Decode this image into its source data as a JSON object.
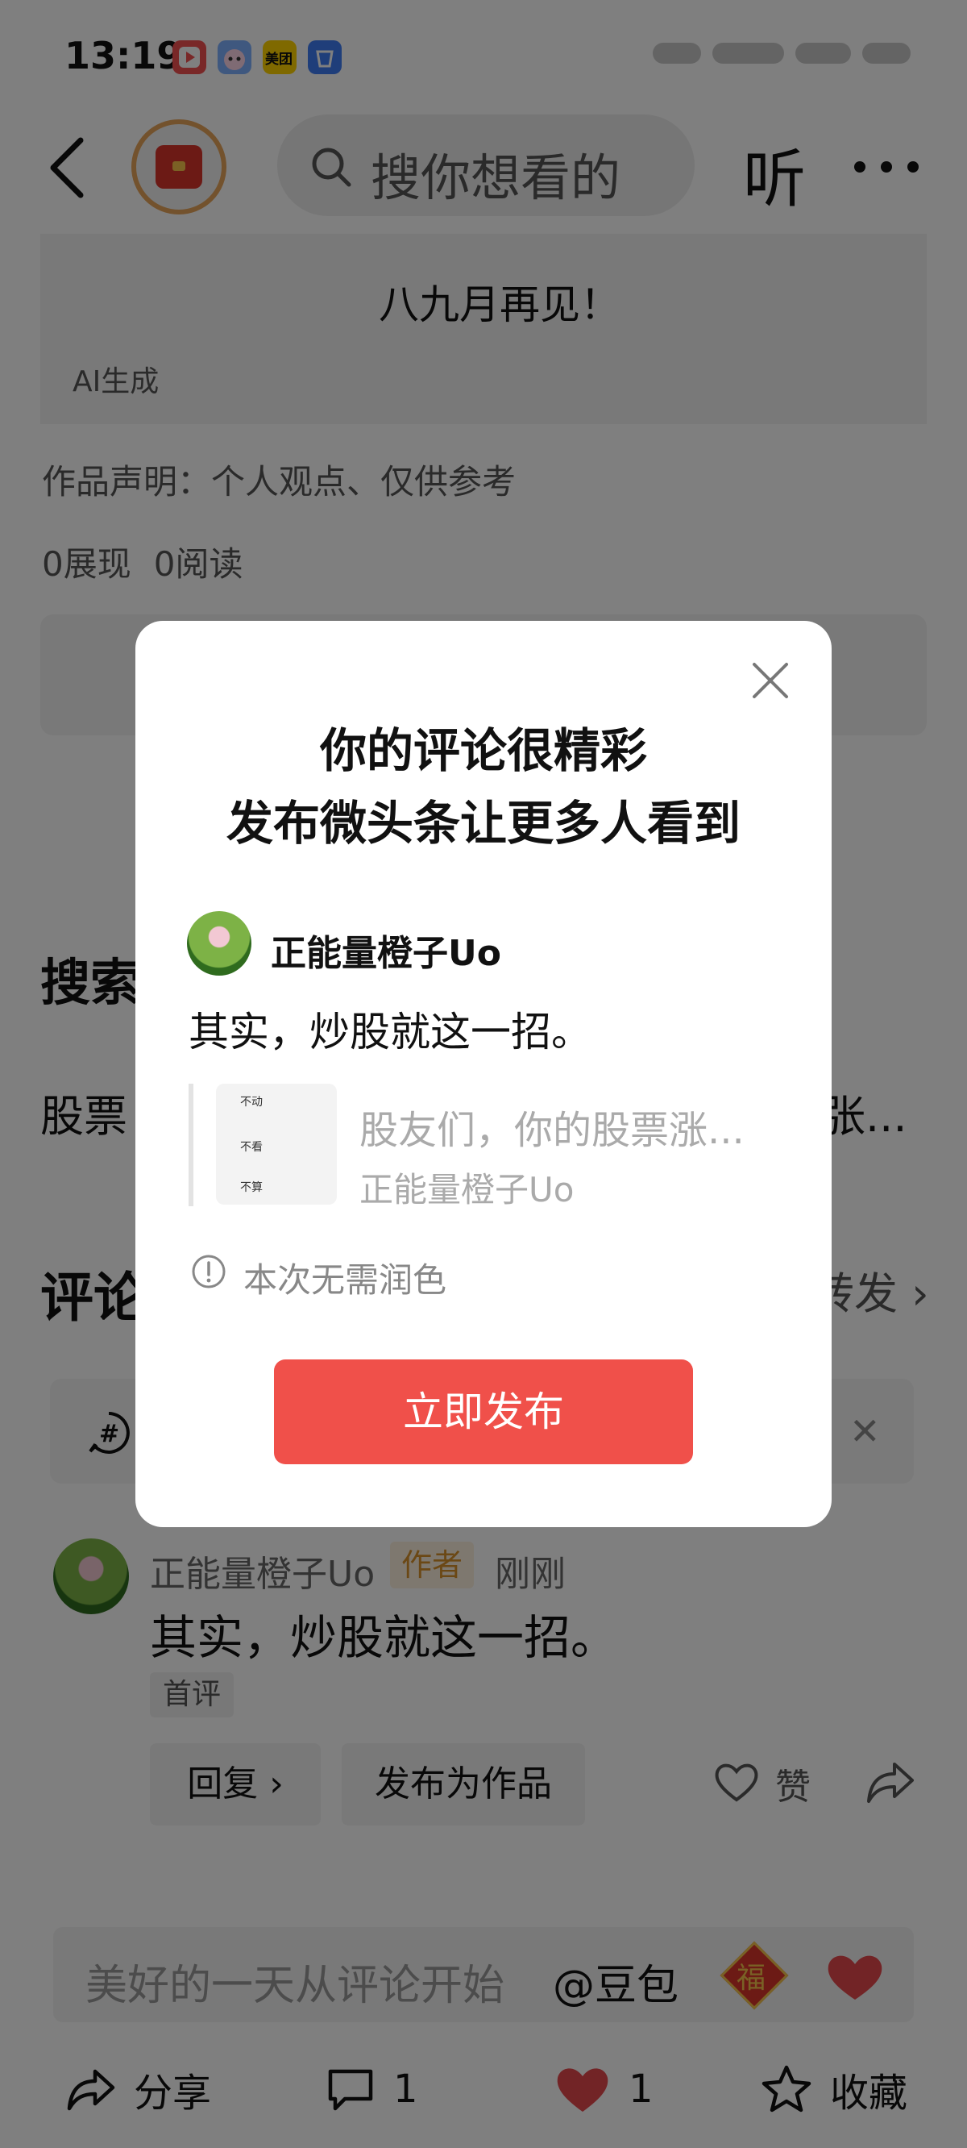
{
  "status_bar": {
    "time": "13:19",
    "app_icons": [
      "video-app-icon",
      "bot-app-icon",
      "meituan-app-icon",
      "app-market-icon"
    ],
    "meituan_label": "美团"
  },
  "top_bar": {
    "search_placeholder": "搜你想看的",
    "listen_label": "听"
  },
  "article": {
    "image_caption": "八九月再见！",
    "ai_tag": "AI生成",
    "statement": "作品声明：个人观点、仅供参考",
    "views": "0展现",
    "reads": "0阅读"
  },
  "search_section": {
    "heading": "搜索",
    "query_prefix": "股票",
    "query_suffix": "张..."
  },
  "comments": {
    "heading": "评论",
    "forward_label": "转发",
    "items": [
      {
        "author": "正能量橙子Uo",
        "badge": "作者",
        "time": "刚刚",
        "text": "其实，炒股就这一招。",
        "first_tag": "首评",
        "reply_label": "回复",
        "publish_as_work_label": "发布为作品",
        "like_label": "赞"
      }
    ]
  },
  "input_bar": {
    "placeholder": "美好的一天从评论开始",
    "mention": "@豆包",
    "fu_char": "福"
  },
  "bottom_bar": {
    "share": "分享",
    "comments_count": "1",
    "likes_count": "1",
    "collect": "收藏"
  },
  "modal": {
    "title_line1": "你的评论很精彩",
    "title_line2": "发布微头条让更多人看到",
    "author": "正能量橙子Uo",
    "text": "其实，炒股就这一招。",
    "quote_title": "股友们，你的股票涨...",
    "quote_author": "正能量橙子Uo",
    "thumb_lines": [
      "不动",
      "不看",
      "不算"
    ],
    "info": "本次无需润色",
    "publish_label": "立即发布"
  },
  "colors": {
    "accent": "#f0504a",
    "author_badge": "#d7902b",
    "heart": "#e5484d"
  }
}
